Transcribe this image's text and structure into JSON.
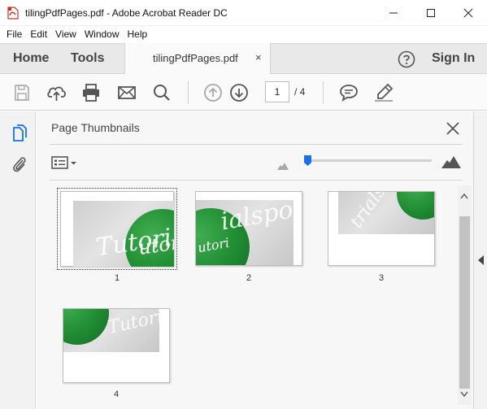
{
  "window": {
    "title": "tilingPdfPages.pdf - Adobe Acrobat Reader DC",
    "app_icon": "acrobat-pdf-icon"
  },
  "menu": [
    "File",
    "Edit",
    "View",
    "Window",
    "Help"
  ],
  "tabs": {
    "home": "Home",
    "tools": "Tools",
    "document": "tilingPdfPages.pdf",
    "close": "×",
    "sign_in": "Sign In"
  },
  "toolbar": {
    "icons": [
      "save-icon",
      "cloud-upload-icon",
      "print-icon",
      "email-icon",
      "search-icon",
      "page-up-icon",
      "page-down-icon",
      "comment-icon",
      "highlight-pen-icon"
    ],
    "current_page": "1",
    "page_total": "/ 4"
  },
  "panel": {
    "title": "Page Thumbnails",
    "accent_color": "#1473e6",
    "thumbnails": [
      {
        "label": "1",
        "selected": true
      },
      {
        "label": "2",
        "selected": false
      },
      {
        "label": "3",
        "selected": false
      },
      {
        "label": "4",
        "selected": false
      }
    ]
  }
}
